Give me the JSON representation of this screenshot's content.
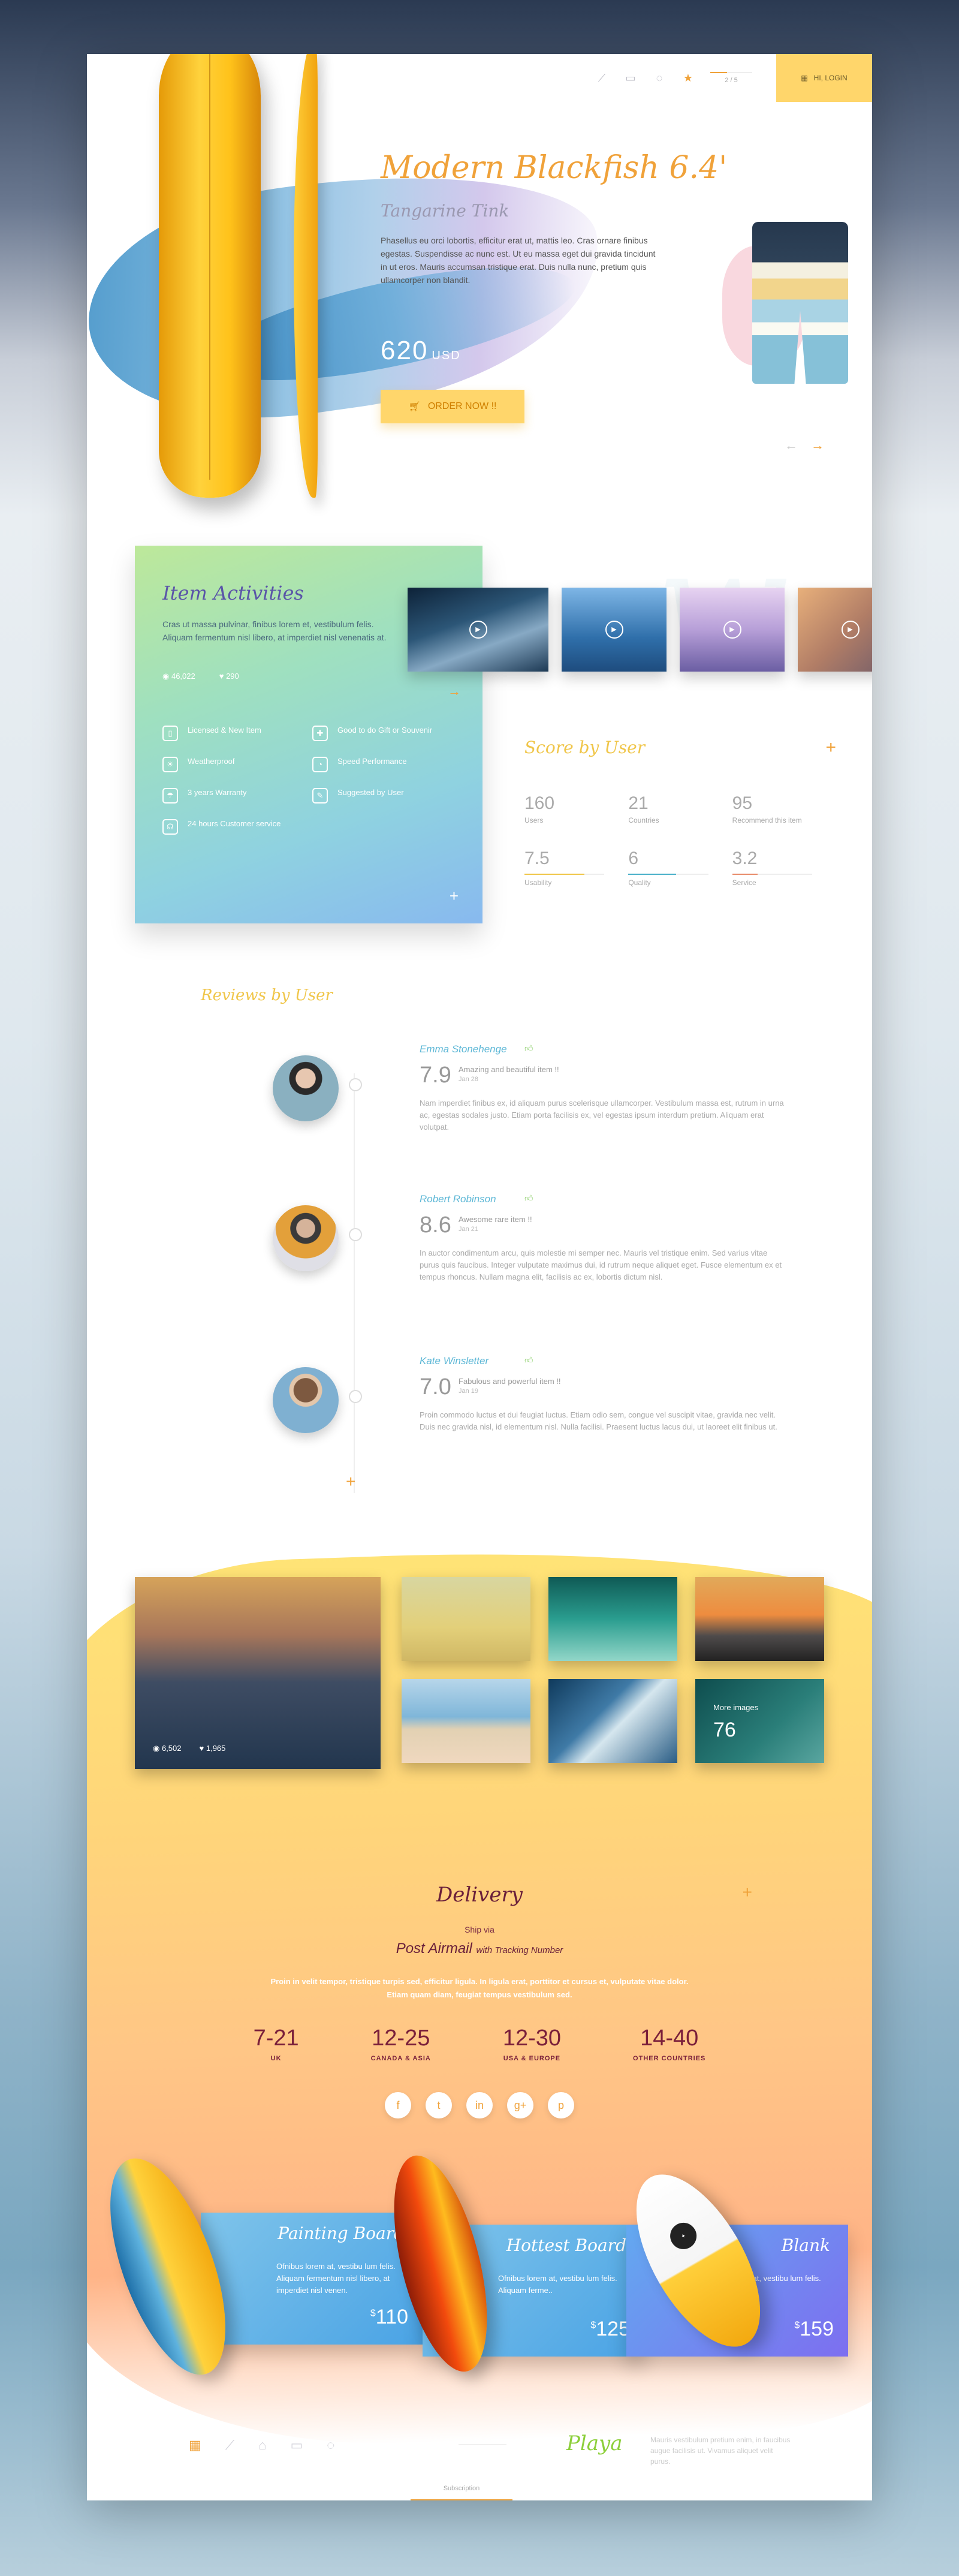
{
  "header": {
    "pager": "2 / 5",
    "pager_progress": 0.4,
    "login_label": "HI, LOGIN",
    "nav_icons": [
      "chart-icon",
      "layers-icon",
      "chat-icon",
      "star-icon"
    ]
  },
  "hero": {
    "title": "Modern Blackfish 6.4'",
    "subtitle": "Tangarine Tink",
    "description": "Phasellus eu orci lobortis, efficitur erat ut, mattis leo. Cras ornare finibus egestas. Suspendisse ac nunc est. Ut eu massa eget dui gravida tincidunt in ut eros. Mauris accumsan tristique erat. Duis nulla nunc, pretium quis ullamcorper non blandit.",
    "price": "620",
    "currency": "USD",
    "order_label": "ORDER NOW !!"
  },
  "activities": {
    "title": "Item Activities",
    "text": "Cras ut massa pulvinar, finibus lorem et, vestibulum felis. Aliquam fermentum nisl libero, at imperdiet nisl venenatis at.",
    "views": "46,022",
    "likes": "290",
    "features": [
      {
        "icon": "book-icon",
        "label": "Licensed & New Item"
      },
      {
        "icon": "gift-icon",
        "label": "Good to do Gift or Souvenir"
      },
      {
        "icon": "sun-icon",
        "label": "Weatherproof"
      },
      {
        "icon": "gauge-icon",
        "label": "Speed Performance"
      },
      {
        "icon": "umbrella-icon",
        "label": "3 years Warranty"
      },
      {
        "icon": "pin-icon",
        "label": "Suggested by User"
      },
      {
        "icon": "headset-icon",
        "label": "24 hours Customer service"
      }
    ]
  },
  "score": {
    "title": "Score by User",
    "stats": [
      {
        "value": "160",
        "label": "Users"
      },
      {
        "value": "21",
        "label": "Countries"
      },
      {
        "value": "95",
        "label": "Recommend this item"
      },
      {
        "value": "7.5",
        "label": "Usability",
        "fill": 0.75,
        "color": "#f0c64a"
      },
      {
        "value": "6",
        "label": "Quality",
        "fill": 0.6,
        "color": "#4ab0c9"
      },
      {
        "value": "3.2",
        "label": "Service",
        "fill": 0.32,
        "color": "#e88c6a"
      }
    ]
  },
  "reviews": {
    "title": "Reviews by User",
    "items": [
      {
        "name": "Emma Stonehenge",
        "score": "7.9",
        "headline": "Amazing and beautiful item !!",
        "date": "Jan 28",
        "text": "Nam imperdiet finibus ex, id aliquam purus scelerisque ullamcorper. Vestibulum massa est, rutrum in urna ac, egestas sodales justo. Etiam porta facilisis ex, vel egestas ipsum interdum pretium. Aliquam erat volutpat."
      },
      {
        "name": "Robert Robinson",
        "score": "8.6",
        "headline": "Awesome rare item !!",
        "date": "Jan 21",
        "text": "In auctor condimentum arcu, quis molestie mi semper nec. Mauris vel tristique enim. Sed varius vitae purus quis faucibus. Integer vulputate maximus dui, id rutrum neque aliquet eget. Fusce elementum ex et tempus rhoncus. Nullam magna elit, facilisis ac ex, lobortis dictum nisl."
      },
      {
        "name": "Kate Winsletter",
        "score": "7.0",
        "headline": "Fabulous and powerful item !!",
        "date": "Jan 19",
        "text": "Proin commodo luctus et dui feugiat luctus. Etiam odio sem, congue vel suscipit vitae, gravida nec velit. Duis nec gravida nisl, id elementum nisl. Nulla facilisi. Praesent luctus lacus dui, ut laoreet elit finibus ut."
      }
    ]
  },
  "gallery": {
    "views": "6,502",
    "likes": "1,965",
    "more_label": "More images",
    "more_count": "76"
  },
  "delivery": {
    "title": "Delivery",
    "ship_via": "Ship via",
    "method": "Post Airmail",
    "method_suffix": "with Tracking Number",
    "text": "Proin in velit tempor, tristique turpis sed, efficitur ligula. In ligula erat, porttitor et cursus et, vulputate vitae dolor. Etiam quam diam, feugiat tempus vestibulum sed.",
    "rates": [
      {
        "days": "7-21",
        "region": "UK"
      },
      {
        "days": "12-25",
        "region": "CANADA & ASIA"
      },
      {
        "days": "12-30",
        "region": "USA & EUROPE"
      },
      {
        "days": "14-40",
        "region": "OTHER COUNTRIES"
      }
    ],
    "social": [
      "f",
      "t",
      "in",
      "g+",
      "p"
    ]
  },
  "products": [
    {
      "name": "Painting Board",
      "text": "Ofnibus lorem at, vestibu lum felis. Aliquam fermentum nisl libero, at imperdiet nisl venen.",
      "price": "110"
    },
    {
      "name": "Hottest Board",
      "text": "Ofnibus lorem at, vestibu lum felis. Aliquam ferme..",
      "price": "125"
    },
    {
      "name": "Blank",
      "text": "Ofnibus lorem at, vestibu lum felis. Aliquam ferme..",
      "price": "159"
    }
  ],
  "footer": {
    "logo": "Playa",
    "text": "Mauris vestibulum pretium enim, in faucibus augue facilisis ut. Vivamus aliquet velit purus.",
    "subscribe": "Subscription"
  }
}
